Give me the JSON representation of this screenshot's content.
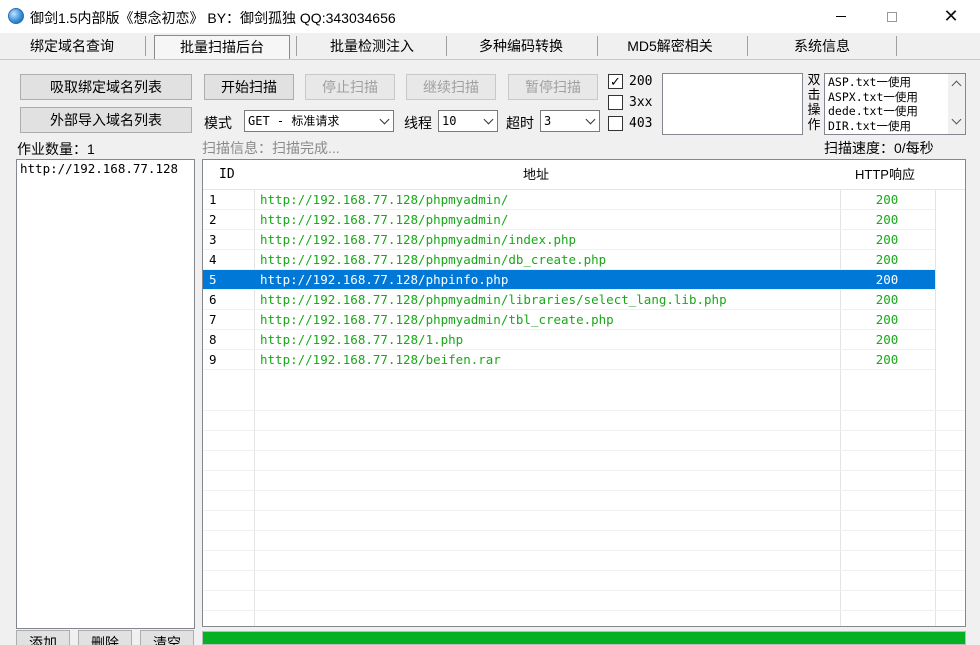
{
  "window": {
    "title": "御剑1.5内部版《想念初恋》 BY：御剑孤独 QQ:343034656"
  },
  "tabs": [
    {
      "label": "绑定域名查询"
    },
    {
      "label": "批量扫描后台"
    },
    {
      "label": "批量检测注入"
    },
    {
      "label": "多种编码转换"
    },
    {
      "label": "MD5解密相关"
    },
    {
      "label": "系统信息"
    }
  ],
  "left": {
    "fetch_button": "吸取绑定域名列表",
    "import_button": "外部导入域名列表",
    "job_count_label": "作业数量：1",
    "domains": [
      "http://192.168.77.128"
    ],
    "add_button": "添加",
    "delete_button": "删除",
    "clear_button": "清空"
  },
  "toolbar": {
    "start_button": "开始扫描",
    "stop_button": "停止扫描",
    "continue_button": "继续扫描",
    "pause_button": "暂停扫描",
    "mode_label": "模式",
    "mode_value": "GET - 标准请求",
    "thread_label": "线程",
    "thread_value": "10",
    "timeout_label": "超时",
    "timeout_value": "3",
    "status_filters": [
      {
        "label": "200",
        "checked": true
      },
      {
        "label": "3xx",
        "checked": false
      },
      {
        "label": "403",
        "checked": false
      }
    ],
    "dict_side_label": [
      "双",
      "击",
      "操",
      "作"
    ],
    "dict_files": [
      "ASP.txt一使用",
      "ASPX.txt一使用",
      "dede.txt一使用",
      "DIR.txt一使用"
    ]
  },
  "status": {
    "scan_info": "扫描信息：扫描完成...",
    "scan_speed": "扫描速度：0/每秒"
  },
  "results": {
    "headers": {
      "id": "ID",
      "url": "地址",
      "code": "HTTP响应"
    },
    "rows": [
      {
        "id": "1",
        "url": "http://192.168.77.128/phpmyadmin/",
        "code": "200"
      },
      {
        "id": "2",
        "url": "http://192.168.77.128/phpmyadmin/",
        "code": "200"
      },
      {
        "id": "3",
        "url": "http://192.168.77.128/phpmyadmin/index.php",
        "code": "200"
      },
      {
        "id": "4",
        "url": "http://192.168.77.128/phpmyadmin/db_create.php",
        "code": "200"
      },
      {
        "id": "5",
        "url": "http://192.168.77.128/phpinfo.php",
        "code": "200",
        "selected": true
      },
      {
        "id": "6",
        "url": "http://192.168.77.128/phpmyadmin/libraries/select_lang.lib.php",
        "code": "200"
      },
      {
        "id": "7",
        "url": "http://192.168.77.128/phpmyadmin/tbl_create.php",
        "code": "200"
      },
      {
        "id": "8",
        "url": "http://192.168.77.128/1.php",
        "code": "200"
      },
      {
        "id": "9",
        "url": "http://192.168.77.128/beifen.rar",
        "code": "200"
      }
    ]
  },
  "progress": {
    "value": 1.0,
    "color": "#06b025"
  },
  "colors": {
    "ok_text": "#18a818",
    "selection": "#0078d7"
  }
}
